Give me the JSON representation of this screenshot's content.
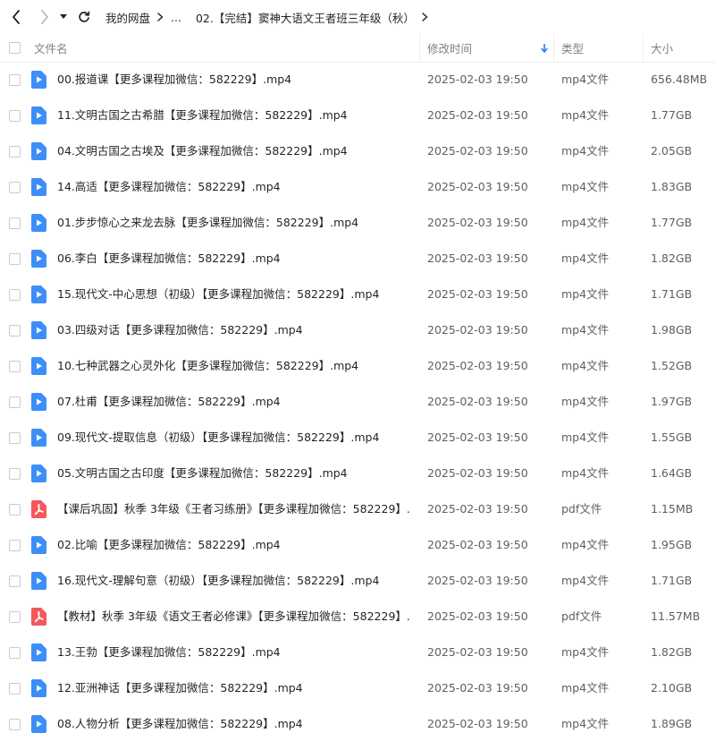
{
  "toolbar": {
    "breadcrumb": [
      "我的网盘",
      "...",
      "02.【完结】窦神大语文王者班三年级（秋）"
    ]
  },
  "columns": {
    "name": "文件名",
    "modified": "修改时间",
    "type": "类型",
    "size": "大小"
  },
  "files": [
    {
      "name": "00.报道课【更多课程加微信：582229】.mp4",
      "modified": "2025-02-03 19:50",
      "type": "mp4文件",
      "size": "656.48MB",
      "icon": "video-file-icon"
    },
    {
      "name": "11.文明古国之古希腊【更多课程加微信：582229】.mp4",
      "modified": "2025-02-03 19:50",
      "type": "mp4文件",
      "size": "1.77GB",
      "icon": "video-file-icon"
    },
    {
      "name": "04.文明古国之古埃及【更多课程加微信：582229】.mp4",
      "modified": "2025-02-03 19:50",
      "type": "mp4文件",
      "size": "2.05GB",
      "icon": "video-file-icon"
    },
    {
      "name": "14.高适【更多课程加微信：582229】.mp4",
      "modified": "2025-02-03 19:50",
      "type": "mp4文件",
      "size": "1.83GB",
      "icon": "video-file-icon"
    },
    {
      "name": "01.步步惊心之来龙去脉【更多课程加微信：582229】.mp4",
      "modified": "2025-02-03 19:50",
      "type": "mp4文件",
      "size": "1.77GB",
      "icon": "video-file-icon"
    },
    {
      "name": "06.李白【更多课程加微信：582229】.mp4",
      "modified": "2025-02-03 19:50",
      "type": "mp4文件",
      "size": "1.82GB",
      "icon": "video-file-icon"
    },
    {
      "name": "15.现代文-中心思想（初级）【更多课程加微信：582229】.mp4",
      "modified": "2025-02-03 19:50",
      "type": "mp4文件",
      "size": "1.71GB",
      "icon": "video-file-icon"
    },
    {
      "name": "03.四级对话【更多课程加微信：582229】.mp4",
      "modified": "2025-02-03 19:50",
      "type": "mp4文件",
      "size": "1.98GB",
      "icon": "video-file-icon"
    },
    {
      "name": "10.七种武器之心灵外化【更多课程加微信：582229】.mp4",
      "modified": "2025-02-03 19:50",
      "type": "mp4文件",
      "size": "1.52GB",
      "icon": "video-file-icon"
    },
    {
      "name": "07.杜甫【更多课程加微信：582229】.mp4",
      "modified": "2025-02-03 19:50",
      "type": "mp4文件",
      "size": "1.97GB",
      "icon": "video-file-icon"
    },
    {
      "name": "09.现代文-提取信息（初级）【更多课程加微信：582229】.mp4",
      "modified": "2025-02-03 19:50",
      "type": "mp4文件",
      "size": "1.55GB",
      "icon": "video-file-icon"
    },
    {
      "name": "05.文明古国之古印度【更多课程加微信：582229】.mp4",
      "modified": "2025-02-03 19:50",
      "type": "mp4文件",
      "size": "1.64GB",
      "icon": "video-file-icon"
    },
    {
      "name": "【课后巩固】秋季 3年级《王者习练册》【更多课程加微信：582229】....",
      "modified": "2025-02-03 19:50",
      "type": "pdf文件",
      "size": "1.15MB",
      "icon": "pdf-file-icon"
    },
    {
      "name": "02.比喻【更多课程加微信：582229】.mp4",
      "modified": "2025-02-03 19:50",
      "type": "mp4文件",
      "size": "1.95GB",
      "icon": "video-file-icon"
    },
    {
      "name": "16.现代文-理解句意（初级）【更多课程加微信：582229】.mp4",
      "modified": "2025-02-03 19:50",
      "type": "mp4文件",
      "size": "1.71GB",
      "icon": "video-file-icon"
    },
    {
      "name": "【教材】秋季 3年级《语文王者必修课》【更多课程加微信：582229】....",
      "modified": "2025-02-03 19:50",
      "type": "pdf文件",
      "size": "11.57MB",
      "icon": "pdf-file-icon"
    },
    {
      "name": "13.王勃【更多课程加微信：582229】.mp4",
      "modified": "2025-02-03 19:50",
      "type": "mp4文件",
      "size": "1.82GB",
      "icon": "video-file-icon"
    },
    {
      "name": "12.亚洲神话【更多课程加微信：582229】.mp4",
      "modified": "2025-02-03 19:50",
      "type": "mp4文件",
      "size": "2.10GB",
      "icon": "video-file-icon"
    },
    {
      "name": "08.人物分析【更多课程加微信：582229】.mp4",
      "modified": "2025-02-03 19:50",
      "type": "mp4文件",
      "size": "1.89GB",
      "icon": "video-file-icon"
    }
  ],
  "colors": {
    "video_icon": "#3d8ef8",
    "pdf_icon": "#f4585b",
    "sort_arrow": "#2c7bf5"
  }
}
